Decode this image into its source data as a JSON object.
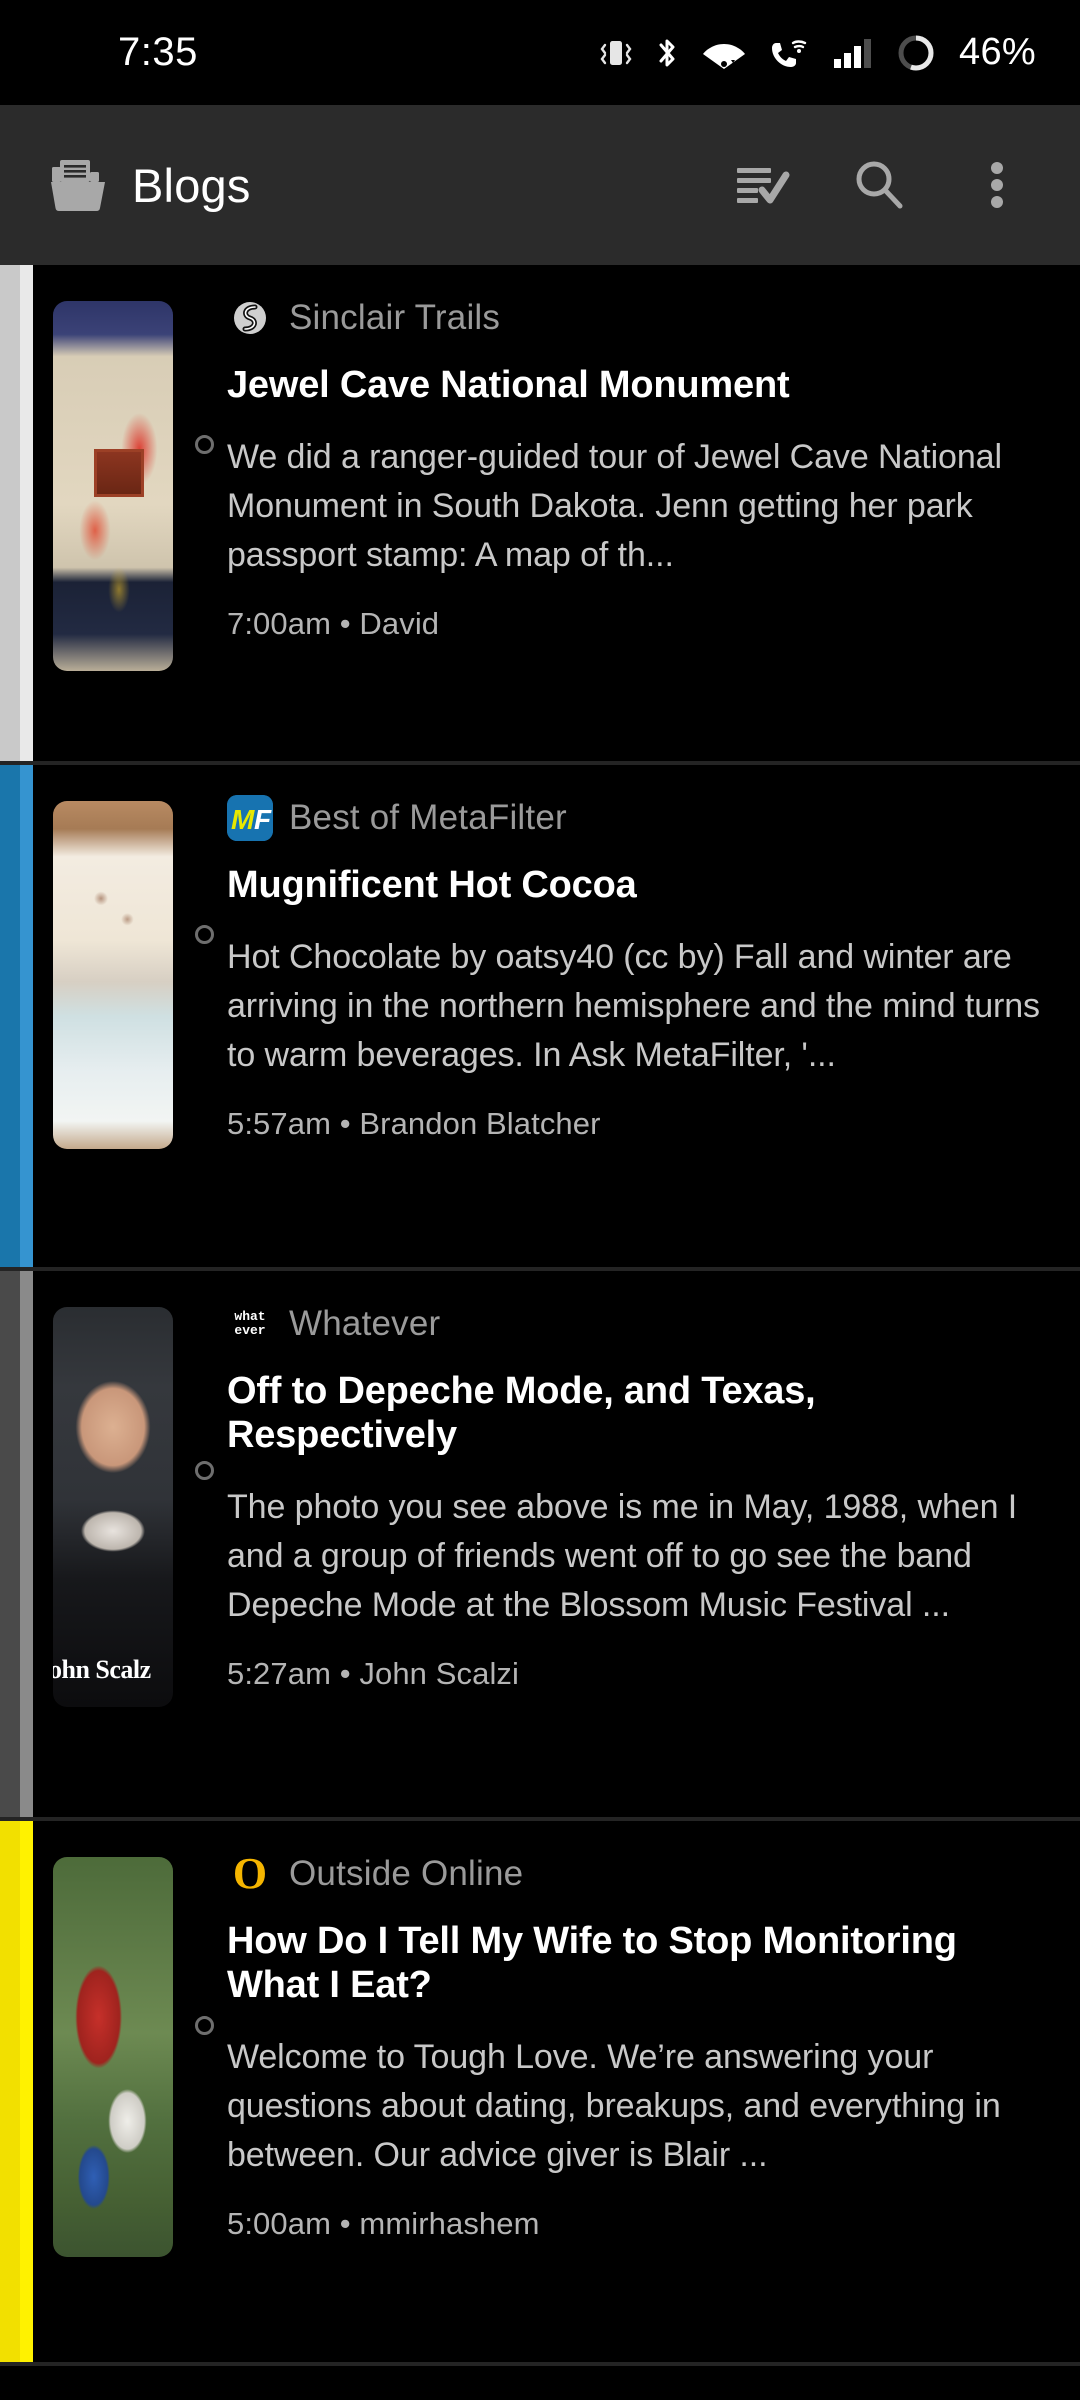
{
  "statusbar": {
    "time": "7:35",
    "battery_text": "46%",
    "icons": [
      "vibrate-icon",
      "bluetooth-icon",
      "wifi-icon",
      "wifi-calling-icon",
      "cellular-signal-icon",
      "battery-circle-icon"
    ]
  },
  "appbar": {
    "title": "Blogs",
    "folder_icon": "folder-articles-icon",
    "actions": [
      {
        "name": "mark-all-read-button",
        "icon": "playlist-add-check-icon"
      },
      {
        "name": "search-button",
        "icon": "search-icon"
      },
      {
        "name": "overflow-menu-button",
        "icon": "more-vert-icon"
      }
    ]
  },
  "articles": [
    {
      "feed": "Sinclair Trails",
      "favicon": "sinclair-trails-favicon",
      "title": "Jewel Cave National Monument",
      "snippet": "We did a ranger-guided tour of Jewel Cave National Monument in South Dakota.    Jenn getting her park passport stamp:        A map of th...",
      "time": "7:00am",
      "separator": "•",
      "author": "David",
      "accent_outer": "#c9c9c9",
      "accent_inner": "#e9e9e9",
      "unread": true
    },
    {
      "feed": "Best of MetaFilter",
      "favicon": "metafilter-favicon",
      "title": "Mugnificent Hot Cocoa",
      "snippet": "Hot Chocolate by oatsy40 (cc by)  Fall and winter are arriving in the northern hemisphere and the mind turns to warm beverages. In Ask MetaFilter, '...",
      "time": "5:57am",
      "separator": "•",
      "author": "Brandon Blatcher",
      "accent_outer": "#1a76ab",
      "accent_inner": "#3594d0",
      "unread": true
    },
    {
      "feed": "Whatever",
      "favicon": "whatever-favicon",
      "favicon_text_top": "what",
      "favicon_text_bottom": "ever",
      "title": "Off to Depeche Mode, and Texas, Respectively",
      "snippet": "The photo you see above is me in May, 1988, when I and a group of friends went off to go see the band Depeche Mode at the Blossom Music Festival ...",
      "time": "5:27am",
      "separator": "•",
      "author": "John Scalzi",
      "accent_outer": "#4a4a4a",
      "accent_inner": "#8a8a8a",
      "unread": true
    },
    {
      "feed": "Outside Online",
      "favicon": "outside-online-favicon",
      "favicon_text": "O",
      "title": "How Do I Tell My Wife to Stop Monitoring What I Eat?",
      "snippet": "Welcome to Tough Love. We’re answering your questions about dating, breakups, and everything in between. Our advice giver is Blair ...",
      "time": "5:00am",
      "separator": "•",
      "author": "mmirhashem",
      "accent_outer": "#f2e000",
      "accent_inner": "#fff200",
      "unread": true
    }
  ],
  "colors": {
    "background": "#000000",
    "appbar_bg": "#2b2b2b",
    "title_text": "#ffffff",
    "feed_text": "#9a9a9a",
    "snippet_text": "#c8c8c8",
    "meta_text": "#b4b4b4",
    "divider": "#242424"
  }
}
